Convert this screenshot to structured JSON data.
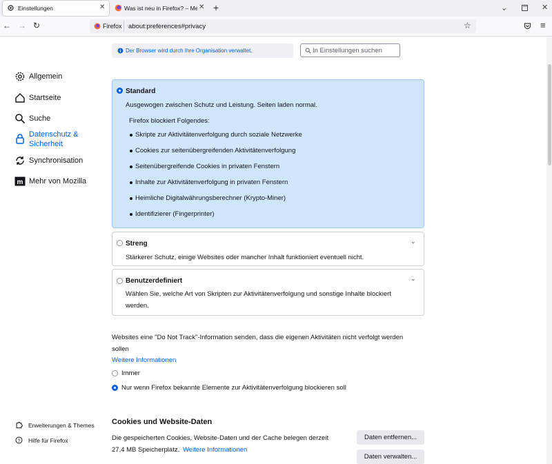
{
  "tabs": [
    {
      "title": "Einstellungen",
      "icon": "gear-icon"
    },
    {
      "title": "Was ist neu in Firefox? – Mehr F",
      "icon": "firefox-logo-icon"
    }
  ],
  "nav": {
    "identity": "Firefox",
    "url": "about:preferences#privacy"
  },
  "sidebar": {
    "items": [
      {
        "label": "Allgemein",
        "icon": "gear-icon"
      },
      {
        "label": "Startseite",
        "icon": "home-icon"
      },
      {
        "label": "Suche",
        "icon": "search-icon"
      },
      {
        "label_line1": "Datenschutz &",
        "label_line2": "Sicherheit",
        "icon": "lock-icon"
      },
      {
        "label": "Synchronisation",
        "icon": "sync-icon"
      },
      {
        "label": "Mehr von Mozilla",
        "icon": "mozilla-icon"
      }
    ],
    "footer": [
      {
        "label": "Erweiterungen & Themes",
        "icon": "puzzle-icon"
      },
      {
        "label": "Hilfe für Firefox",
        "icon": "help-icon"
      }
    ]
  },
  "policy_notice": "Der Browser wird durch Ihre Organisation verwaltet.",
  "search": {
    "placeholder": "In Einstellungen suchen"
  },
  "standard": {
    "title": "Standard",
    "description": "Ausgewogen zwischen Schutz und Leistung. Seiten laden normal.",
    "blocks_heading": "Firefox blockiert Folgendes:",
    "items": [
      "Skripte zur Aktivitätenverfolgung durch soziale Netzwerke",
      "Cookies zur seitenübergreifenden Aktivitätenverfolgung",
      "Seitenübergreifende Cookies in privaten Fenstern",
      "Inhalte zur Aktivitätenverfolgung in privaten Fenstern",
      "Heimliche Digitalwährungsberechner (Krypto-Miner)",
      "Identifizierer (Fingerprinter)"
    ]
  },
  "strict": {
    "title": "Streng",
    "description": "Stärkerer Schutz, einige Websites oder mancher Inhalt funktioniert eventuell nicht."
  },
  "custom": {
    "title": "Benutzerdefiniert",
    "description_line1": "Wählen Sie, welche Art von Skripten zur Aktivitätenverfolgung und sonstige Inhalte blockiert",
    "description_line2": "werden."
  },
  "dnt": {
    "text_line1": "Websites eine \"Do Not Track\"-Information senden, dass die eigenen Aktivitäten nicht verfolgt werden",
    "text_line2": "sollen",
    "link": "Weitere Informationen",
    "option_always": "Immer",
    "option_only": "Nur wenn Firefox bekannte Elemente zur Aktivitätenverfolgung blockieren soll"
  },
  "cookies": {
    "heading": "Cookies und Website-Daten",
    "text_line1": "Die gespeicherten Cookies, Website-Daten und der Cache belegen derzeit",
    "text_line2": "27,4 MB Speicherplatz.",
    "link": "Weitere Informationen",
    "remove_button": "Daten entfernen...",
    "manage_button": "Daten verwalten..."
  },
  "colors": {
    "accent": "#0061e0",
    "selected_bg": "#cfe6fd"
  }
}
